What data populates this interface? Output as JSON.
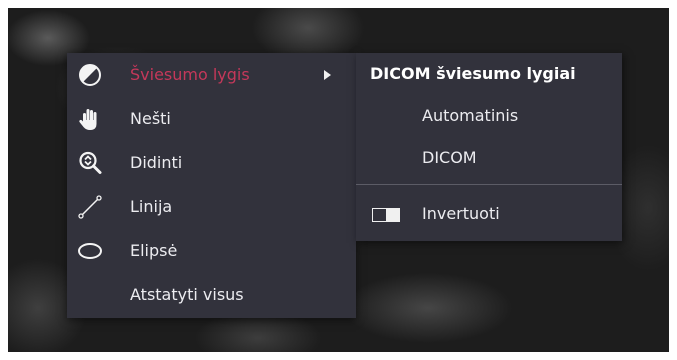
{
  "main_menu": {
    "items": [
      {
        "label": "Šviesumo lygis",
        "icon": "contrast-icon",
        "active": true,
        "has_submenu": true
      },
      {
        "label": "Nešti",
        "icon": "hand-pan-icon"
      },
      {
        "label": "Didinti",
        "icon": "zoom-icon"
      },
      {
        "label": "Linija",
        "icon": "line-measure-icon"
      },
      {
        "label": "Elipsė",
        "icon": "ellipse-icon"
      },
      {
        "label": "Atstatyti visus"
      }
    ]
  },
  "submenu": {
    "title": "DICOM šviesumo lygiai",
    "items": [
      {
        "label": "Automatinis"
      },
      {
        "label": "DICOM"
      },
      {
        "label": "Invertuoti",
        "icon": "invert-icon"
      }
    ]
  },
  "colors": {
    "menu_background": "#32323c",
    "active_text": "#c4385a",
    "text": "#ececf0"
  }
}
